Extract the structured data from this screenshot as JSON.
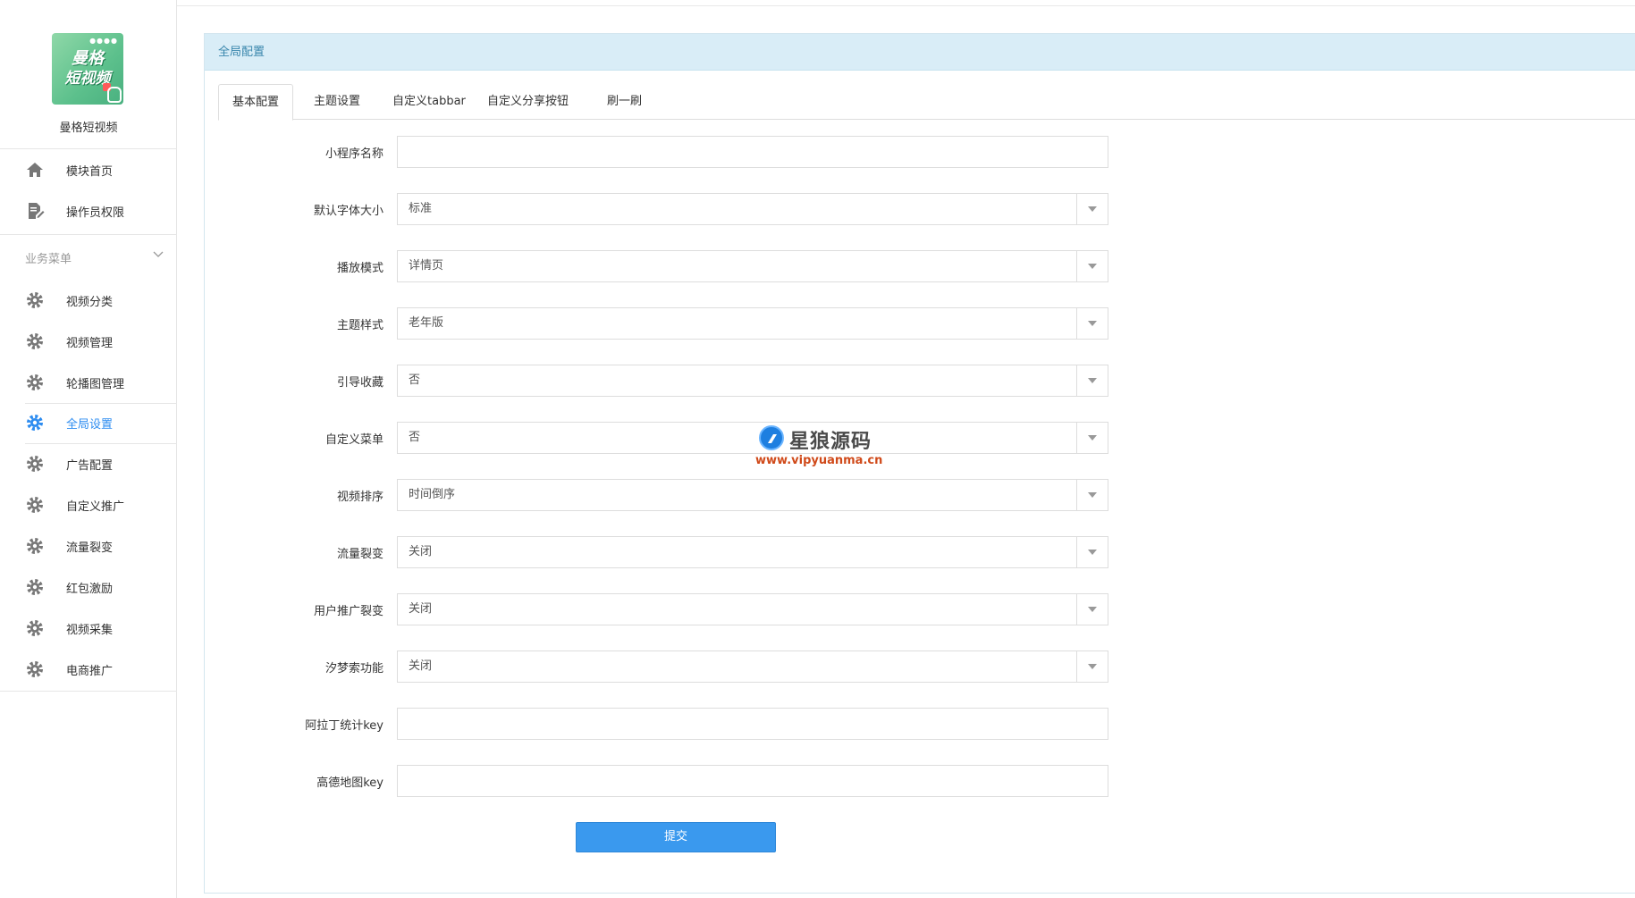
{
  "sidebar": {
    "brand_name": "曼格短视频",
    "logo": {
      "line1": "曼格",
      "line2": "短视频"
    },
    "top_items": [
      {
        "label": "模块首页",
        "icon": "home-icon"
      },
      {
        "label": "操作员权限",
        "icon": "document-edit-icon"
      }
    ],
    "group_title": "业务菜单",
    "items": [
      {
        "label": "视频分类",
        "icon": "gear-icon"
      },
      {
        "label": "视频管理",
        "icon": "gear-icon"
      },
      {
        "label": "轮播图管理",
        "icon": "gear-icon"
      },
      {
        "label": "全局设置",
        "icon": "gear-icon",
        "active": true
      },
      {
        "label": "广告配置",
        "icon": "gear-icon"
      },
      {
        "label": "自定义推广",
        "icon": "gear-icon"
      },
      {
        "label": "流量裂变",
        "icon": "gear-icon"
      },
      {
        "label": "红包激励",
        "icon": "gear-icon"
      },
      {
        "label": "视频采集",
        "icon": "gear-icon"
      },
      {
        "label": "电商推广",
        "icon": "gear-icon"
      }
    ]
  },
  "panel": {
    "title": "全局配置",
    "tabs": [
      {
        "label": "基本配置",
        "active": true
      },
      {
        "label": "主题设置"
      },
      {
        "label": "自定义tabbar"
      },
      {
        "label": "自定义分享按钮"
      },
      {
        "label": "刷一刷"
      }
    ]
  },
  "form": {
    "fields": [
      {
        "label": "小程序名称",
        "type": "text",
        "value": ""
      },
      {
        "label": "默认字体大小",
        "type": "select",
        "value": "标准"
      },
      {
        "label": "播放模式",
        "type": "select",
        "value": "详情页"
      },
      {
        "label": "主题样式",
        "type": "select",
        "value": "老年版"
      },
      {
        "label": "引导收藏",
        "type": "select",
        "value": "否"
      },
      {
        "label": "自定义菜单",
        "type": "select",
        "value": "否"
      },
      {
        "label": "视频排序",
        "type": "select",
        "value": "时间倒序"
      },
      {
        "label": "流量裂变",
        "type": "select",
        "value": "关闭"
      },
      {
        "label": "用户推广裂变",
        "type": "select",
        "value": "关闭"
      },
      {
        "label": "汐梦索功能",
        "type": "select",
        "value": "关闭"
      },
      {
        "label": "阿拉丁统计key",
        "type": "text",
        "value": ""
      },
      {
        "label": "高德地图key",
        "type": "text",
        "value": ""
      }
    ],
    "submit_label": "提交"
  },
  "watermark": {
    "name": "星狼源码",
    "url": "www.vipyuanma.cn"
  },
  "colors": {
    "accent": "#2d8cf0",
    "panel_header": "#d9edf7",
    "submit": "#3a99ee"
  }
}
